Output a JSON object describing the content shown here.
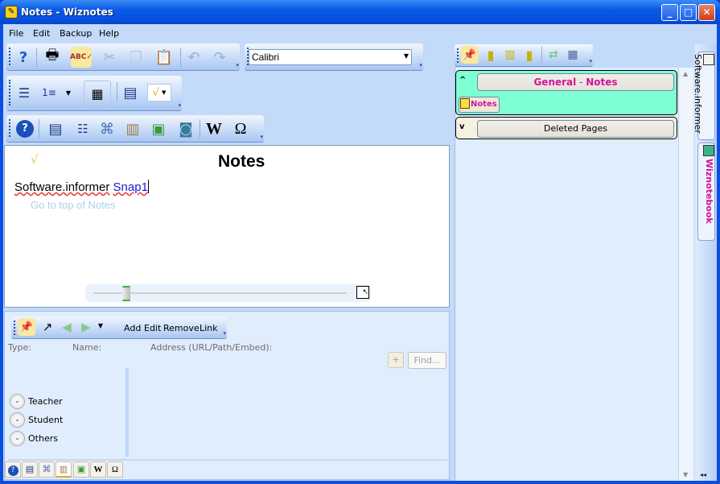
{
  "window": {
    "title": "Notes - Wiznotes",
    "app_icon": "wiznotes-app-icon",
    "minimize": "minimize",
    "maximize": "maximize",
    "close": "close"
  },
  "menu": [
    "File",
    "Edit",
    "Backup",
    "Help"
  ],
  "toolbar1": {
    "icons": [
      "help-icon",
      "print-icon",
      "spellcheck-icon",
      "cut-icon",
      "copy-icon",
      "paste-icon",
      "undo-icon",
      "redo-icon"
    ]
  },
  "font_selector": {
    "value": "Calibri"
  },
  "toolbar2": {
    "icons": [
      "insert-line-icon",
      "numbered-list-icon",
      "list-dropdown-icon",
      "table-icon",
      "note-template-icon",
      "checkmark-dropdown-icon"
    ]
  },
  "toolbar3": {
    "icons": [
      "help-circle-icon",
      "page-icon",
      "outline-icon",
      "binoculars-icon",
      "filing-cabinet-icon",
      "media-link-icon",
      "camera-icon",
      "wikipedia-icon",
      "omega-icon"
    ],
    "wiki_glyph": "W",
    "omega_glyph": "Ω"
  },
  "editor": {
    "title": "Notes",
    "check_glyph": "√",
    "line_text": "Software.informer",
    "line_link": "Snap1",
    "goto_top": "Go to top of Notes",
    "zoom_level_fraction": 0.13
  },
  "links_panel": {
    "buttons": {
      "add": "Add",
      "edit": "Edit",
      "remove": "Remove",
      "link": "Link"
    },
    "columns": {
      "type": "Type:",
      "name": "Name:",
      "address": "Address (URL/Path/Embed):"
    },
    "plus": "+",
    "find": "Find...",
    "categories": [
      "Teacher",
      "Student",
      "Others"
    ]
  },
  "bottom_tabs": [
    "help",
    "page",
    "find",
    "links",
    "media",
    "wikipedia",
    "symbols"
  ],
  "bottom_tab_glyphs": {
    "wikipedia": "W",
    "symbols": "Ω"
  },
  "right_panel": {
    "toolbar_icons": [
      "pin-icon",
      "new-notebook-icon",
      "notebook-ring-icon",
      "notebook-stack-icon",
      "sync-arrows-icon",
      "calendar-icon"
    ],
    "groups": [
      {
        "title_main": "General",
        "title_sep": " - ",
        "title_sub": "Notes",
        "expanded": true,
        "toggle": "^",
        "pages": [
          "Notes"
        ]
      },
      {
        "title_main": "Deleted Pages",
        "expanded": false,
        "toggle": "v"
      }
    ]
  },
  "side_tabs": [
    {
      "label": "Software.informer"
    },
    {
      "label": "Wiznotebook",
      "active": true
    }
  ],
  "colors": {
    "accent_pink": "#d2149a",
    "group_teal": "#7fffd4",
    "titlebar_blue": "#0a5ae6",
    "link_blue": "#1a1ad8"
  }
}
